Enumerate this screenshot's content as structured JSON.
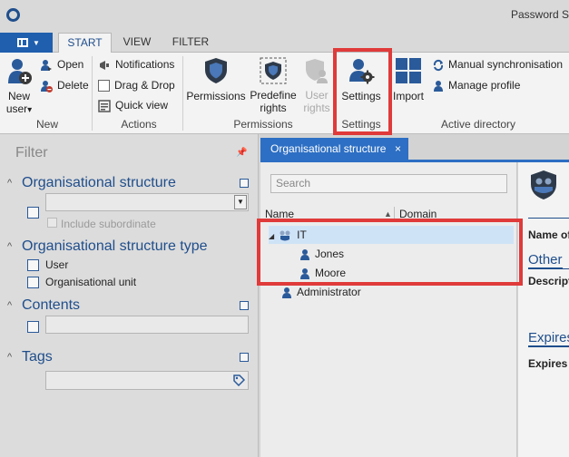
{
  "app": {
    "title": "Password S"
  },
  "ribbon_tabs": [
    "START",
    "VIEW",
    "FILTER"
  ],
  "ribbon": {
    "new_user": {
      "line1": "New",
      "line2": "user",
      "caret": "▾"
    },
    "open": "Open",
    "delete": "Delete",
    "notifications": "Notifications",
    "drag_drop": "Drag & Drop",
    "quick_view": "Quick view",
    "permissions": "Permissions",
    "predefine": {
      "line1": "Predefine",
      "line2": "rights"
    },
    "user_rights": {
      "line1": "User",
      "line2": "rights"
    },
    "settings": "Settings",
    "import": "Import",
    "manual_sync": "Manual synchronisation",
    "manage_profile": "Manage profile",
    "groups": {
      "new": "New",
      "actions": "Actions",
      "permissions": "Permissions",
      "settings": "Settings",
      "active_directory": "Active directory"
    }
  },
  "filter": {
    "title": "Filter",
    "org_structure": {
      "title": "Organisational structure",
      "include_subordinate": "Include subordinate"
    },
    "org_type": {
      "title": "Organisational structure type",
      "options": [
        "User",
        "Organisational unit"
      ]
    },
    "contents": {
      "title": "Contents"
    },
    "tags": {
      "title": "Tags"
    }
  },
  "main": {
    "tab_label": "Organisational structure",
    "tab_close": "×",
    "search_placeholder": "Search",
    "columns": [
      "Name",
      "Domain"
    ],
    "tree": [
      {
        "label": "IT",
        "type": "group",
        "expanded": true
      },
      {
        "label": "Jones",
        "type": "user"
      },
      {
        "label": "Moore",
        "type": "user"
      },
      {
        "label": "Administrator",
        "type": "user"
      }
    ]
  },
  "details": {
    "name_label": "Name of",
    "other_link": "Other",
    "description_label": "Descripti",
    "expires_link": "Expires",
    "expires_label": "Expires"
  },
  "colors": {
    "accent": "#1f4e8c",
    "tab_active": "#2d6fc4",
    "highlight": "#e03a3a",
    "selection": "#cfe3f7"
  }
}
